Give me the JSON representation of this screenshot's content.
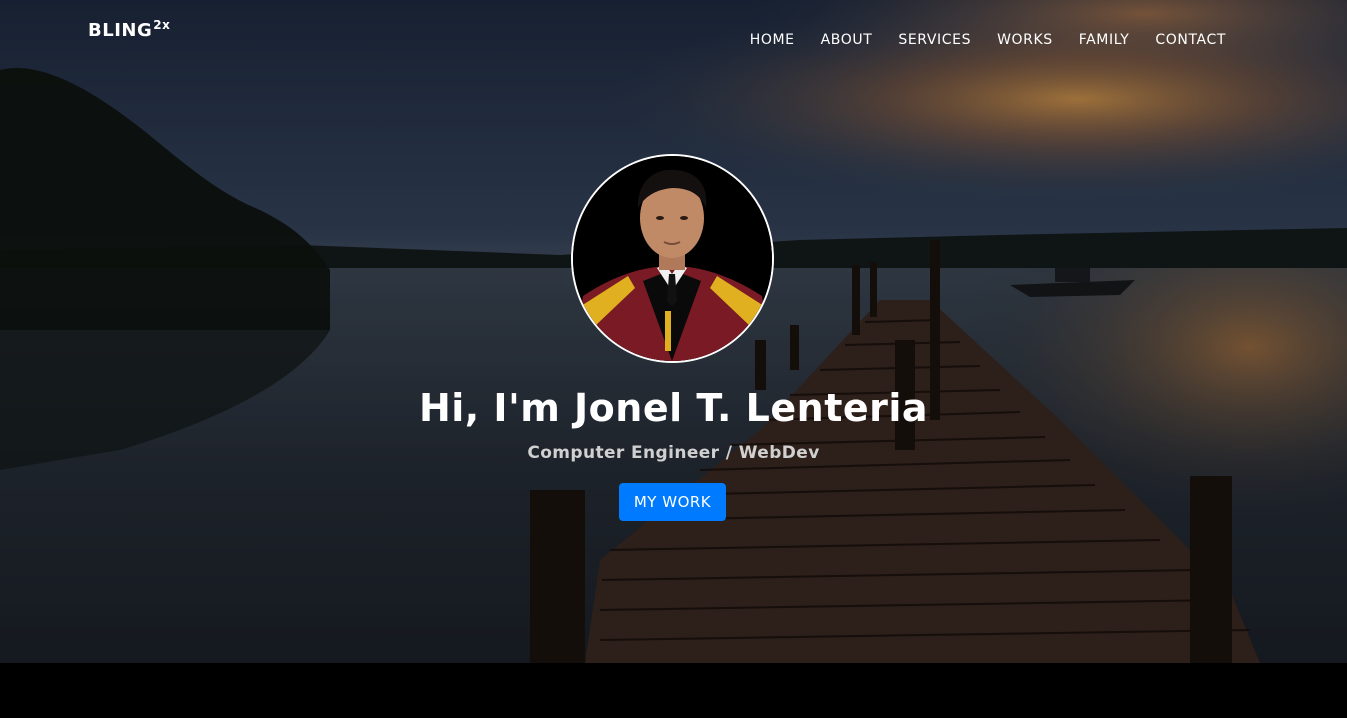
{
  "brand": {
    "name": "BLING",
    "superscript": "2x"
  },
  "nav": {
    "items": [
      {
        "label": "HOME"
      },
      {
        "label": "ABOUT"
      },
      {
        "label": "SERVICES"
      },
      {
        "label": "WORKS"
      },
      {
        "label": "FAMILY"
      },
      {
        "label": "CONTACT"
      }
    ]
  },
  "hero": {
    "headline": "Hi, I'm Jonel T. Lenteria",
    "subtitle": "Computer Engineer / WebDev",
    "cta_label": "MY WORK",
    "background_image": "sunset-lake-wooden-pier",
    "avatar_image": "graduation-portrait"
  },
  "colors": {
    "cta": "#007bff",
    "text": "#ffffff",
    "subtitle": "#d0d0d0",
    "footer": "#000000"
  }
}
